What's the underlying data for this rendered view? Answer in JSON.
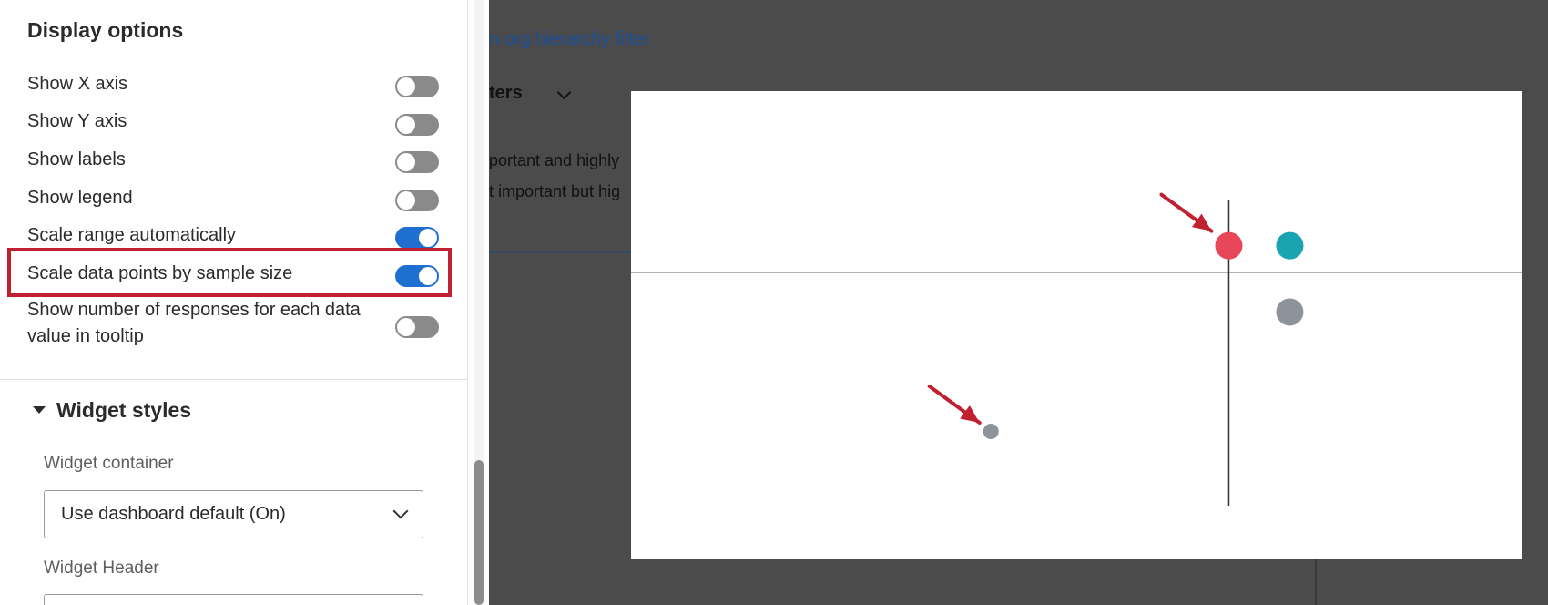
{
  "settings_panel": {
    "section_title": "Display options",
    "options": [
      {
        "label": "Show X axis",
        "on": false
      },
      {
        "label": "Show Y axis",
        "on": false
      },
      {
        "label": "Show labels",
        "on": false
      },
      {
        "label": "Show legend",
        "on": false
      },
      {
        "label": "Scale range automatically",
        "on": true
      },
      {
        "label": "Scale data points by sample size",
        "on": true,
        "highlighted": true
      },
      {
        "label_line1": "Show number of responses for each data",
        "label_line2": "value in tooltip",
        "on": false
      }
    ],
    "widget_styles": {
      "title": "Widget styles",
      "container_label": "Widget container",
      "container_value": "Use dashboard default (On)",
      "header_label": "Widget Header"
    }
  },
  "background": {
    "link_text": "n org hierarchy filter",
    "filters_text": "ters",
    "line1": "portant and highly",
    "line2": "t important but hig"
  },
  "chart_data": {
    "type": "scatter",
    "title": "",
    "xlabel": "",
    "ylabel": "",
    "quadrant_axes": true,
    "points": [
      {
        "x": -3.9,
        "y": -1.2,
        "size": "small",
        "color": "#8e939b",
        "annotated": true
      },
      {
        "x": 0.0,
        "y": 0.2,
        "size": "large",
        "color": "#e8475a",
        "annotated": true
      },
      {
        "x": 1.0,
        "y": 0.2,
        "size": "large",
        "color": "#1aa3b0",
        "annotated": false
      },
      {
        "x": 1.0,
        "y": -0.3,
        "size": "large",
        "color": "#8e939b",
        "annotated": false
      }
    ],
    "xlim": [
      -9.8,
      4.8
    ],
    "ylim": [
      -2.0,
      1.2
    ]
  },
  "colors": {
    "toggle_on": "#1f6fd1",
    "toggle_off": "#8a8a8a",
    "highlight": "#c0202f",
    "arrow": "#c0202f"
  }
}
